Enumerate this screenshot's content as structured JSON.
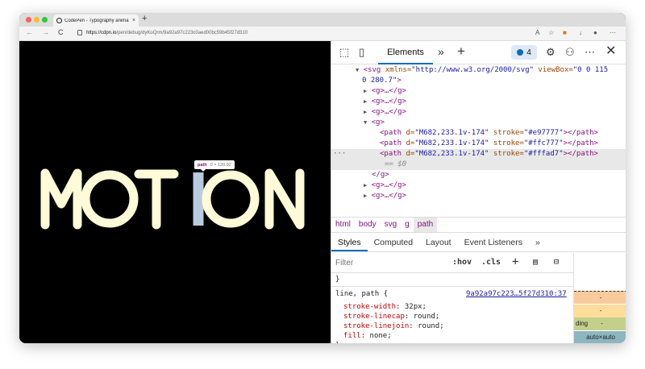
{
  "browser": {
    "tab_title": "CodePen - Typography anima",
    "tab_close": "×",
    "new_tab": "+",
    "url_host": "https://cdpn.io",
    "url_path": "/pen/debug/dyKoQrm/9a92a97c223c0aed00bc59b45f27d310",
    "back": "←",
    "forward": "→",
    "reload": "C"
  },
  "viewport": {
    "letters": [
      "M",
      "O",
      "T",
      "I",
      "O",
      "N"
    ],
    "highlight_color": "#b9cbe0",
    "letter_color": "#fffad7",
    "tooltip_tag": "path",
    "tooltip_size": "0 × 120.92"
  },
  "devtools": {
    "elements_tab": "Elements",
    "more_tabs": "»",
    "add_tab": "+",
    "issues_count": "4",
    "dom": {
      "svg_open_a": "<svg",
      "svg_attr_xmlns": " xmlns=",
      "svg_val_xmlns": "\"http://www.w3.org/2000/svg\"",
      "svg_attr_viewbox": " viewBox=",
      "svg_val_viewbox_a": "\"0 0 115",
      "svg_val_viewbox_b": "0 280.7\"",
      "svg_close": ">",
      "g_collapsed": "<g>…</g>",
      "g_open": "<g>",
      "g_close": "</g>",
      "path_open": "<path",
      "path_attr_d": " d=",
      "path_d": "\"M682,233.1v-174\"",
      "path_attr_stroke": " stroke=",
      "stroke_1": "\"#e97777\"",
      "stroke_2": "\"#ffc777\"",
      "stroke_3": "\"#fffad7\"",
      "path_close": "></path>",
      "dots": "···",
      "eq0": "== $0"
    },
    "breadcrumbs": [
      "html",
      "body",
      "svg",
      "g",
      "path"
    ],
    "subtabs": [
      "Styles",
      "Computed",
      "Layout",
      "Event Listeners",
      "»"
    ],
    "filter_placeholder": "Filter",
    "hov": ":hov",
    "cls": ".cls",
    "css": {
      "prev_close": "}",
      "selector": "line, path {",
      "source": "9a92a97c223…5f27d310:37",
      "props": [
        {
          "name": "stroke-width",
          "value": "32px;"
        },
        {
          "name": "stroke-linecap",
          "value": "round;"
        },
        {
          "name": "stroke-linejoin",
          "value": "round;"
        },
        {
          "name": "fill",
          "value": "none;"
        }
      ],
      "close": "}"
    },
    "boxmodel": {
      "margin_val": "-",
      "border_val": "-",
      "padding_label": "ding",
      "padding_val": "-",
      "content": "auto×auto",
      "bottom_val": "-"
    }
  }
}
